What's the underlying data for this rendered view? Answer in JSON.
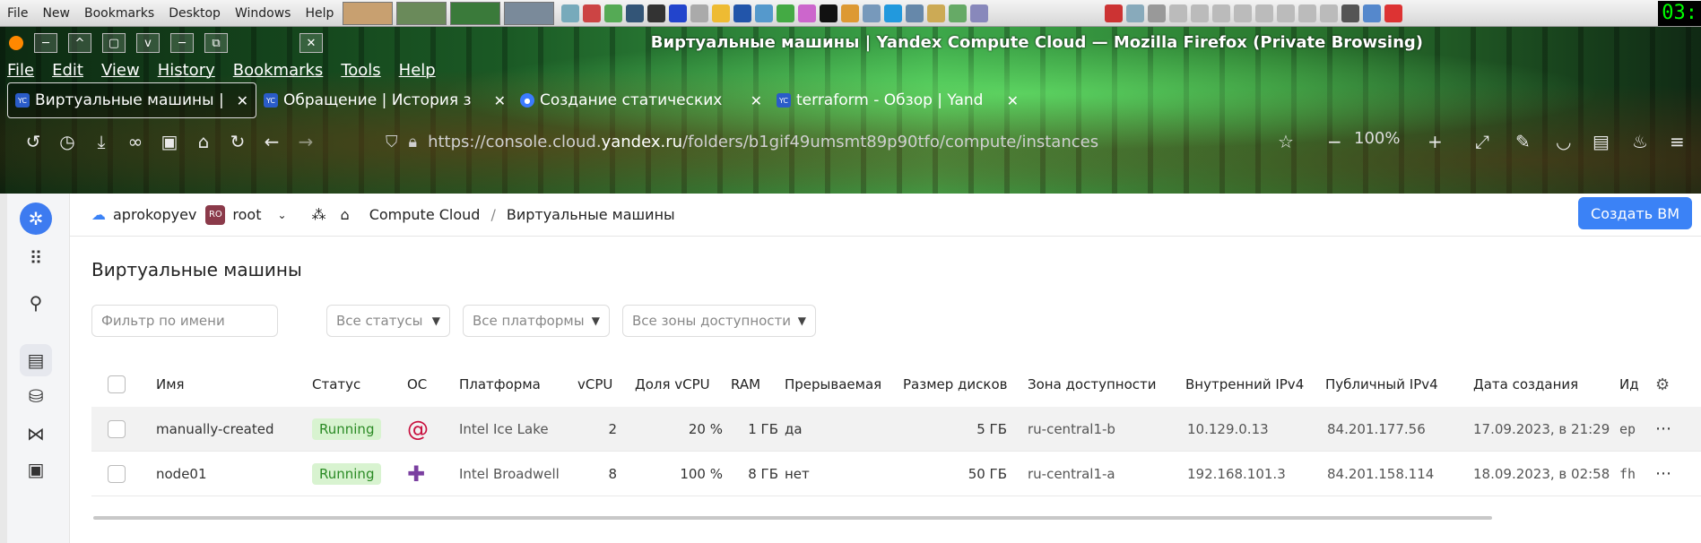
{
  "os": {
    "menu": [
      "File",
      "New",
      "Bookmarks",
      "Desktop",
      "Windows",
      "Help"
    ],
    "clock": "03:"
  },
  "window": {
    "title": "Виртуальные машины | Yandex Compute Cloud — Mozilla Firefox (Private Browsing)",
    "buttons": [
      "─",
      "^",
      "▢",
      "v",
      "─",
      "⧉",
      "✕"
    ]
  },
  "menubar": [
    "File",
    "Edit",
    "View",
    "History",
    "Bookmarks",
    "Tools",
    "Help"
  ],
  "tabs": [
    {
      "label": "Виртуальные машины | ",
      "favicon": "YC"
    },
    {
      "label": "Обращение | История з",
      "favicon": "YC"
    },
    {
      "label": "Создание статических ",
      "favicon": "●"
    },
    {
      "label": "terraform - Обзор | Yand",
      "favicon": "YC"
    }
  ],
  "url": {
    "prefix": "https://console.cloud.",
    "host": "yandex.ru",
    "path": "/folders/b1gif49umsmt89p90tfo/compute/instances"
  },
  "zoom": "100%",
  "topbar": {
    "account": "aprokopyev",
    "role_badge": "RO",
    "role": "root",
    "crumb1": "Compute Cloud",
    "sep": "/",
    "crumb2": "Виртуальные машины",
    "create": "Создать ВМ"
  },
  "page": {
    "title": "Виртуальные машины",
    "filter_placeholder": "Фильтр по имени",
    "status_filter": "Все статусы",
    "platform_filter": "Все платформы",
    "zone_filter": "Все зоны доступности"
  },
  "table": {
    "headers": {
      "name": "Имя",
      "status": "Статус",
      "os": "ОС",
      "platform": "Платформа",
      "vcpu": "vCPU",
      "share": "Доля vCPU",
      "ram": "RAM",
      "preempt": "Прерываемая",
      "disk": "Размер дисков",
      "zone": "Зона доступности",
      "ipv4": "Внутренний IPv4",
      "pub": "Публичный IPv4",
      "created": "Дата создания",
      "id": "Ид"
    },
    "rows": [
      {
        "name": "manually-created",
        "status": "Running",
        "platform": "Intel Ice Lake",
        "vcpu": "2",
        "share": "20 %",
        "ram": "1 ГБ",
        "preempt": "да",
        "disk": "5 ГБ",
        "zone": "ru-central1-b",
        "ipv4": "10.129.0.13",
        "pub": "84.201.177.56",
        "created": "17.09.2023, в 21:29",
        "id": "ep"
      },
      {
        "name": "node01",
        "status": "Running",
        "platform": "Intel Broadwell",
        "vcpu": "8",
        "share": "100 %",
        "ram": "8 ГБ",
        "preempt": "нет",
        "disk": "50 ГБ",
        "zone": "ru-central1-a",
        "ipv4": "192.168.101.3",
        "pub": "84.201.158.114",
        "created": "18.09.2023, в 02:58",
        "id": "fh"
      }
    ]
  }
}
